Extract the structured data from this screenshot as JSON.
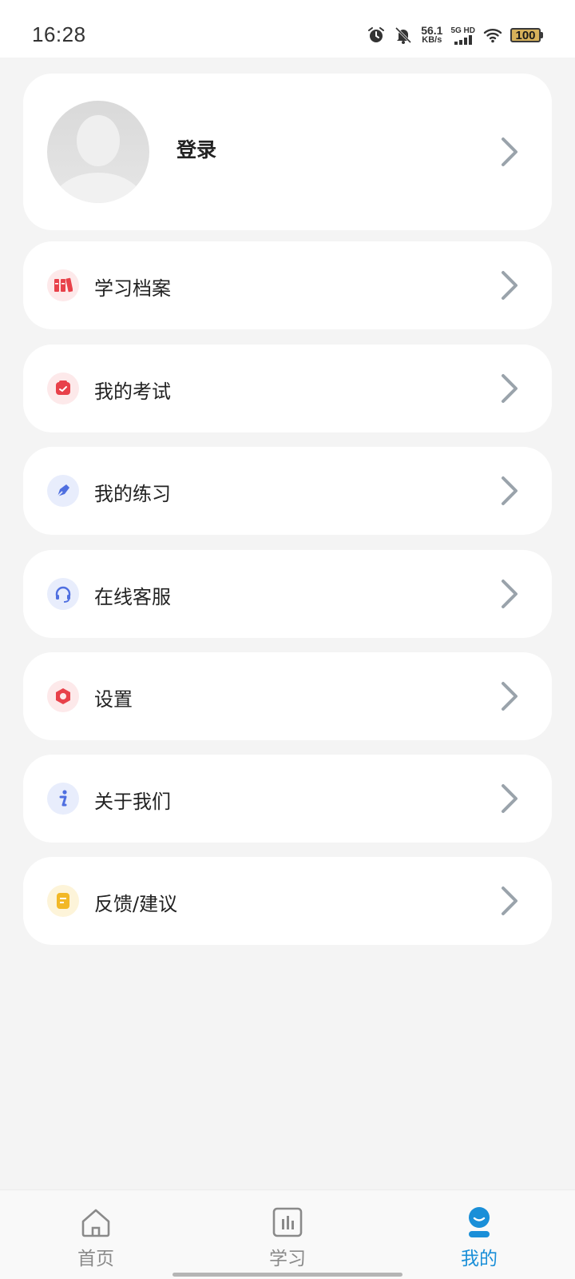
{
  "status_bar": {
    "time": "16:28",
    "net_speed_value": "56.1",
    "net_speed_unit": "KB/s",
    "signal_label": "5G HD",
    "battery": "100",
    "icons": [
      "alarm-icon",
      "bell-muted-icon",
      "signal-icon",
      "wifi-icon",
      "battery-icon"
    ]
  },
  "profile": {
    "login_label": "登录"
  },
  "menu": {
    "items": [
      {
        "label": "学习档案",
        "icon": "books-icon",
        "color": "#e8414a"
      },
      {
        "label": "我的考试",
        "icon": "exam-icon",
        "color": "#e8414a"
      },
      {
        "label": "我的练习",
        "icon": "pen-icon",
        "color": "#4f6fe0"
      },
      {
        "label": "在线客服",
        "icon": "headset-icon",
        "color": "#4f6fe0"
      },
      {
        "label": "设置",
        "icon": "settings-icon",
        "color": "#e8414a"
      },
      {
        "label": "关于我们",
        "icon": "info-icon",
        "color": "#4f6fe0"
      },
      {
        "label": "反馈/建议",
        "icon": "feedback-icon",
        "color": "#f2b826"
      }
    ]
  },
  "bottom_nav": {
    "items": [
      {
        "label": "首页",
        "icon": "home-icon"
      },
      {
        "label": "学习",
        "icon": "study-icon"
      },
      {
        "label": "我的",
        "icon": "profile-icon",
        "active": true
      }
    ]
  },
  "colors": {
    "accent": "#1a8fd8",
    "background": "#f4f4f4",
    "card": "#ffffff",
    "chevron": "#9aa3ab"
  }
}
